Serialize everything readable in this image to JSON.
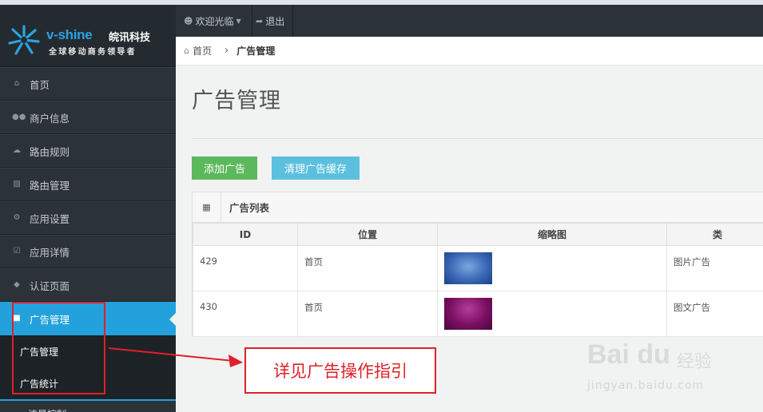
{
  "brand": {
    "name": "v-shine",
    "name_cn": "皖讯科技",
    "slogan": "全球移动商务领导者"
  },
  "topnav": {
    "welcome": "欢迎光临",
    "logout": "退出"
  },
  "sidebar": {
    "items": [
      {
        "label": "首页",
        "icon": "home-icon"
      },
      {
        "label": "商户信息",
        "icon": "users-icon"
      },
      {
        "label": "路由规则",
        "icon": "cloud-icon"
      },
      {
        "label": "路由管理",
        "icon": "sitemap-icon"
      },
      {
        "label": "应用设置",
        "icon": "cogs-icon"
      },
      {
        "label": "应用详情",
        "icon": "check-square-icon"
      },
      {
        "label": "认证页面",
        "icon": "tag-icon"
      },
      {
        "label": "广告管理",
        "icon": "file-icon",
        "active": true
      }
    ],
    "submenu": [
      {
        "label": "广告管理"
      },
      {
        "label": "广告统计"
      }
    ],
    "cut_item": "流量控制"
  },
  "breadcrumb": {
    "home": "首页",
    "current": "广告管理"
  },
  "page": {
    "title": "广告管理",
    "add_button": "添加广告",
    "clear_button": "清理广告缓存"
  },
  "panel": {
    "title": "广告列表",
    "columns": [
      "ID",
      "位置",
      "缩略图",
      "类"
    ],
    "rows": [
      {
        "id": "429",
        "position": "首页",
        "thumb": "blue",
        "type": "图片广告"
      },
      {
        "id": "430",
        "position": "首页",
        "thumb": "purple",
        "type": "图文广告"
      }
    ]
  },
  "annotation": {
    "callout": "详见广告操作指引"
  },
  "watermark": {
    "main": "Bai du",
    "cn": "经验",
    "url": "jingyan.baidu.com"
  },
  "colors": {
    "sidebar_bg": "#2b3339",
    "accent": "#23a1dd",
    "btn_green": "#5cb85c",
    "btn_cyan": "#5bc0de",
    "annotation_red": "#e0202a"
  }
}
